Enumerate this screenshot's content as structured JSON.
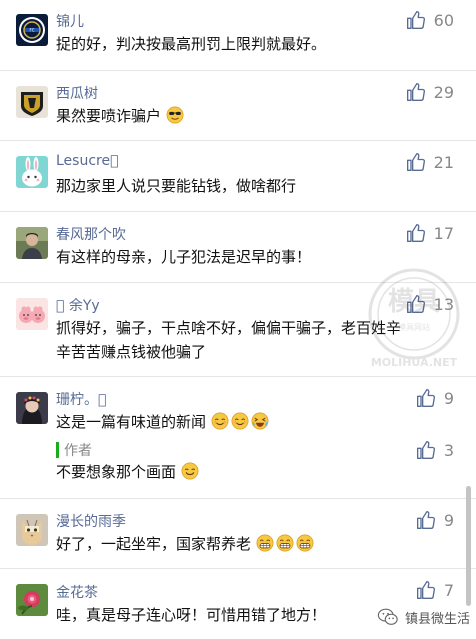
{
  "comments": [
    {
      "name": "锦儿",
      "text": "捉的好，判决按最高刑罚上限判就最好。",
      "likes": "60"
    },
    {
      "name": "西瓜树",
      "text": "果然要喷诈骗户",
      "likes": "29"
    },
    {
      "name": "Lesucre􏿿",
      "text": "那边家里人说只要能钻钱，做啥都行",
      "likes": "21"
    },
    {
      "name": "春风那个吹",
      "text": "有这样的母亲，儿子犯法是迟早的事！",
      "likes": "17"
    },
    {
      "name": "􏿿 余Yy",
      "text": "抓得好，骗子，干点啥不好，偏偏干骗子，老百姓辛辛苦苦赚点钱被他骗了",
      "likes": "13"
    },
    {
      "name": "珊柠。􏿿",
      "text": "这是一篇有味道的新闻",
      "likes": "9",
      "reply": {
        "author": "作者",
        "text": "不要想象那个画面",
        "likes": "3"
      }
    },
    {
      "name": "漫长的雨季",
      "text": "好了，一起坐牢，国家帮养老",
      "likes": "9"
    },
    {
      "name": "金花茶",
      "text": "哇，真是母子连心呀！可惜用错了地方！",
      "likes": "7"
    }
  ],
  "footer": {
    "account": "镇县微生活"
  },
  "watermark": {
    "text": "MOLIHUA.NET",
    "subtitle": "模具网站"
  },
  "colors": {
    "name": "#576b95",
    "text": "#111111",
    "like": "#576b95",
    "count": "#888888",
    "reply_bar": "#1aad19"
  },
  "icons": {
    "like": "thumbs-up-icon",
    "emoji_cool": "sunglasses-emoji-icon",
    "emoji_smile": "smile-emoji-icon",
    "emoji_grin": "grin-emoji-icon",
    "emoji_laugh": "laugh-emoji-icon"
  }
}
